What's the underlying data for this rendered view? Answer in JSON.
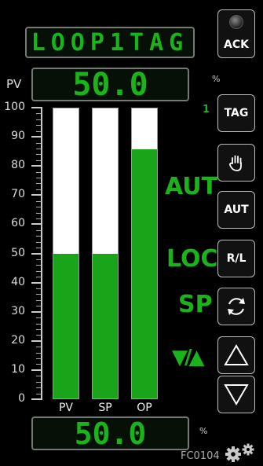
{
  "faceplate": {
    "tag": "LOOP1TAG",
    "pv_label": "PV",
    "pv_value": "50.0",
    "pv_unit": "%",
    "op_value": "50.0",
    "op_unit": "%",
    "tag_index": "1",
    "instrument_id": "FC0104"
  },
  "scale": {
    "labels": [
      "100",
      "90",
      "80",
      "70",
      "60",
      "50",
      "40",
      "30",
      "20",
      "10",
      "0"
    ]
  },
  "bars": [
    {
      "label": "PV",
      "level_percent": 50
    },
    {
      "label": "SP",
      "level_percent": 50
    },
    {
      "label": "OP",
      "level_percent": 86
    }
  ],
  "status": {
    "mode": "AUT",
    "control": "LOC",
    "setpoint_source": "SP",
    "ramp_symbol": "▼/▲"
  },
  "buttons": {
    "ack": "ACK",
    "tag": "TAG",
    "aut": "AUT",
    "rl": "R/L"
  },
  "colors": {
    "background": "#000000",
    "accent_green": "#1bb31b",
    "bar_fill": "#1aa41a",
    "bar_empty": "#ffffff"
  }
}
